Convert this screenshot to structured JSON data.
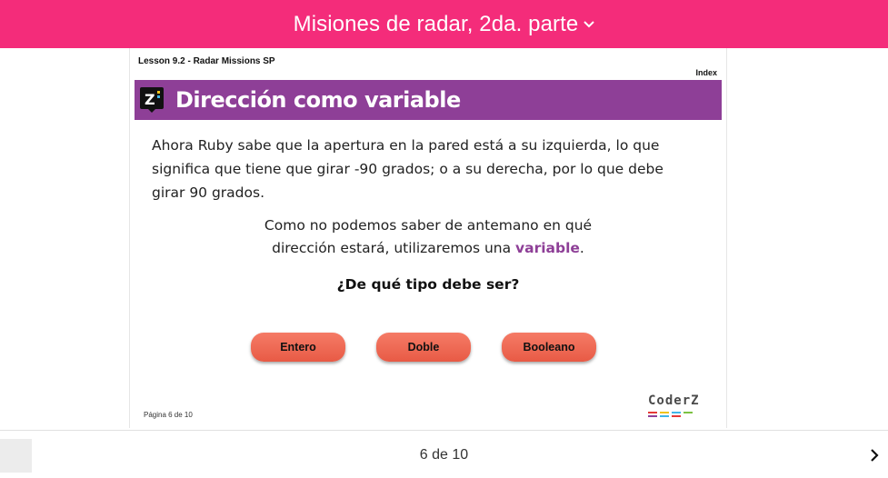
{
  "header": {
    "title": "Misiones de radar, 2da. parte"
  },
  "slide": {
    "lesson": "Lesson 9.2 - Radar Missions SP",
    "index_link": "Index",
    "heading": "Dirección como variable",
    "paragraph_lines": [
      "Ahora Ruby sabe que la apertura en la pared está a su izquierda, lo que",
      "significa que tiene que girar -90 grados; o a su derecha, por lo que debe",
      "girar 90 grados."
    ],
    "centered_line1": "Como no podemos saber de antemano en qué",
    "centered_line2_prefix": "dirección estará, utilizaremos una ",
    "centered_line2_highlight": "variable",
    "centered_line2_suffix": ".",
    "question": "¿De qué tipo debe ser?",
    "answers": [
      "Entero",
      "Doble",
      "Booleano"
    ],
    "page_label": "Página 6 de 10",
    "brand": "CoderZ"
  },
  "footer": {
    "page_count": "6 de 10"
  },
  "colors": {
    "topbar": "#f42c7a",
    "banner": "#8e3f97",
    "button": "#ef6a54",
    "highlight": "#8e3f97"
  },
  "icons": {
    "title_dropdown": "chevron-down-icon",
    "next": "chevron-right-icon",
    "logo": "coderz-logo-icon"
  }
}
